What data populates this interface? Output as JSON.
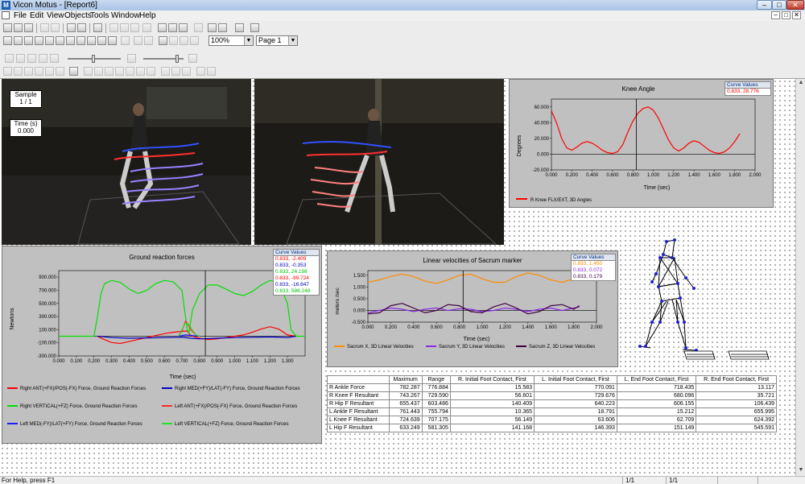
{
  "window": {
    "title": "Vicon Motus - [Report6]",
    "logo": "M"
  },
  "menu": [
    "File",
    "Edit",
    "View",
    "Objects",
    "Tools",
    "Window",
    "Help"
  ],
  "toolbar": {
    "zoom": "100%",
    "page": "Page 1"
  },
  "status": {
    "help": "For Help, press F1",
    "pane1": "1/1",
    "pane2": "1/1"
  },
  "video_overlay": {
    "sample_label": "Sample",
    "sample_value": "1 / 1",
    "time_label": "Time (s)",
    "time_value": "0.000"
  },
  "icons": {
    "scroll_up": "▲",
    "scroll_down": "▼",
    "dropdown": "▼",
    "minimize": "–",
    "maximize": "□",
    "close": "✕"
  },
  "curve_values_title": "Curve Values",
  "knee": {
    "chart_data": {
      "type": "line",
      "title": "Knee Angle",
      "xlabel": "Time (sec)",
      "ylabel": "Degrees",
      "xlim": [
        0,
        2
      ],
      "ylim": [
        -20,
        70
      ],
      "xticks": [
        "0.000",
        "0.200",
        "0.400",
        "0.600",
        "0.800",
        "1.000",
        "1.200",
        "1.400",
        "1.600",
        "1.800",
        "2.000"
      ],
      "yticks": [
        "-20.000",
        "0.000",
        "20.000",
        "40.000",
        "60.000"
      ],
      "cursor_x": 0.833,
      "series": [
        {
          "name": "R Knee FLX/EXT, 3D Angles",
          "color": "#ff0000",
          "x": [
            0.0,
            0.05,
            0.1,
            0.15,
            0.2,
            0.25,
            0.3,
            0.35,
            0.4,
            0.45,
            0.5,
            0.55,
            0.6,
            0.65,
            0.7,
            0.75,
            0.8,
            0.85,
            0.9,
            0.95,
            1.0,
            1.05,
            1.1,
            1.15,
            1.2,
            1.25,
            1.3,
            1.35,
            1.4,
            1.45,
            1.5,
            1.55,
            1.6,
            1.65,
            1.7,
            1.75,
            1.8,
            1.85
          ],
          "y": [
            55,
            40,
            20,
            8,
            5,
            9,
            14,
            16,
            14,
            10,
            5,
            2,
            1,
            3,
            12,
            28,
            42,
            52,
            58,
            60,
            56,
            46,
            32,
            18,
            8,
            4,
            8,
            14,
            17,
            15,
            10,
            5,
            2,
            1,
            3,
            8,
            16,
            26
          ]
        }
      ]
    },
    "curve_values": [
      {
        "text": "0.833,  28.776",
        "color": "#ff0000"
      }
    ]
  },
  "grf": {
    "chart_data": {
      "type": "line",
      "title": "Ground reaction forces",
      "xlabel": "Time (sec)",
      "ylabel": "Newtons",
      "xlim": [
        0,
        1.4
      ],
      "ylim": [
        -300,
        1000
      ],
      "xticks": [
        "0.000",
        "0.100",
        "0.200",
        "0.300",
        "0.400",
        "0.500",
        "0.600",
        "0.700",
        "0.800",
        "0.900",
        "1.000",
        "1.100",
        "1.200",
        "1.300"
      ],
      "yticks": [
        "-300.000",
        "-100.000",
        "100.000",
        "300.000",
        "500.000",
        "700.000",
        "900.000"
      ],
      "cursor_x": 0.833,
      "series": [
        {
          "name": "Right ANT(+FX)/POS(-FX) Force, Ground Reaction Forces",
          "color": "#ff0000",
          "x": [
            0.22,
            0.25,
            0.3,
            0.35,
            0.4,
            0.45,
            0.5,
            0.55,
            0.6,
            0.65,
            0.7,
            0.73,
            0.75,
            0.8,
            0.85,
            0.9,
            0.95,
            1.0,
            1.05,
            1.1,
            1.15,
            1.2,
            1.25,
            1.3,
            1.35
          ],
          "y": [
            0,
            -40,
            -95,
            -110,
            -80,
            -50,
            -20,
            10,
            40,
            60,
            75,
            80,
            10,
            -30,
            -50,
            -40,
            -20,
            0,
            20,
            60,
            110,
            145,
            110,
            20,
            0
          ]
        },
        {
          "name": "Right MED(+FY)/LAT(-FY) Force, Ground Reaction Forces",
          "color": "#0000c8",
          "x": [
            0.22,
            0.3,
            0.4,
            0.5,
            0.6,
            0.7,
            0.75,
            0.8,
            0.9,
            1.0,
            1.1,
            1.2,
            1.3,
            1.35
          ],
          "y": [
            0,
            -20,
            -30,
            -25,
            -20,
            -15,
            -30,
            -40,
            -30,
            -20,
            -15,
            -10,
            -20,
            0
          ]
        },
        {
          "name": "Right VERTICAL(+FZ) Force, Ground Reaction Forces",
          "color": "#00e000",
          "x": [
            0,
            0.2,
            0.22,
            0.24,
            0.26,
            0.3,
            0.35,
            0.4,
            0.45,
            0.5,
            0.55,
            0.6,
            0.65,
            0.7,
            0.72,
            0.73,
            0.74,
            0.76,
            0.8,
            0.85,
            0.9,
            0.95,
            1.0,
            1.05,
            1.1,
            1.15,
            1.2,
            1.25,
            1.3,
            1.32,
            1.35,
            1.4
          ],
          "y": [
            0,
            0,
            300,
            650,
            800,
            850,
            820,
            720,
            650,
            700,
            800,
            850,
            830,
            700,
            300,
            100,
            50,
            400,
            650,
            780,
            780,
            720,
            650,
            620,
            680,
            780,
            850,
            820,
            500,
            100,
            0,
            0
          ]
        },
        {
          "name": "Left ANT(+FX)/POS(-FX) Force, Ground Reaction Forces",
          "color": "#ff2a2a",
          "x": [
            0.68,
            0.7,
            0.72,
            0.73,
            0.75,
            0.78,
            0.8
          ],
          "y": [
            0,
            80,
            230,
            200,
            100,
            20,
            0
          ]
        },
        {
          "name": "Left MED(-FY)/LAT(+FY) Force, Ground Reaction Forces",
          "color": "#1c1cff",
          "x": [
            0.68,
            0.72,
            0.76,
            0.8
          ],
          "y": [
            0,
            20,
            10,
            0
          ]
        },
        {
          "name": "Left VERTICAL(+FZ) Force, Ground Reaction Forces",
          "color": "#28e028",
          "x": [
            0.68,
            0.7,
            0.72,
            0.74,
            0.76,
            0.78,
            0.8
          ],
          "y": [
            0,
            100,
            200,
            180,
            90,
            20,
            0
          ]
        }
      ]
    },
    "curve_values": [
      {
        "text": "0.833,  -2.409",
        "color": "#ff0000"
      },
      {
        "text": "0.833,  -0.353",
        "color": "#0000c8"
      },
      {
        "text": "0.833,  24.198",
        "color": "#00c000"
      },
      {
        "text": "0.833,  -99.724",
        "color": "#ff0000"
      },
      {
        "text": "0.833,  -16.847",
        "color": "#0000c8"
      },
      {
        "text": "0.833,  586.248",
        "color": "#00c000"
      }
    ]
  },
  "sacrum": {
    "chart_data": {
      "type": "line",
      "title": "Linear velocities of Sacrum marker",
      "xlabel": "Time (sec)",
      "ylabel": "meters /sec",
      "xlim": [
        0,
        2
      ],
      "ylim": [
        -0.5,
        1.7
      ],
      "xticks": [
        "0.000",
        "0.200",
        "0.400",
        "0.600",
        "0.800",
        "1.000",
        "1.200",
        "1.400",
        "1.600",
        "1.800",
        "2.000"
      ],
      "yticks": [
        "-0.500",
        "0.000",
        "0.500",
        "1.000",
        "1.500"
      ],
      "cursor_x": 0.833,
      "series": [
        {
          "name": "Sacrum X, 3D Linear Velocities",
          "color": "#ff8c00",
          "x": [
            0.0,
            0.1,
            0.2,
            0.3,
            0.4,
            0.5,
            0.6,
            0.7,
            0.8,
            0.9,
            1.0,
            1.1,
            1.2,
            1.3,
            1.4,
            1.5,
            1.6,
            1.7,
            1.8,
            1.85
          ],
          "y": [
            1.2,
            1.3,
            1.45,
            1.55,
            1.45,
            1.25,
            1.15,
            1.3,
            1.5,
            1.55,
            1.35,
            1.2,
            1.2,
            1.45,
            1.6,
            1.5,
            1.3,
            1.2,
            1.35,
            1.45
          ]
        },
        {
          "name": "Sacrum Y, 3D Linear Velocities",
          "color": "#8a2be2",
          "x": [
            0.0,
            0.1,
            0.2,
            0.3,
            0.4,
            0.5,
            0.6,
            0.7,
            0.8,
            0.9,
            1.0,
            1.1,
            1.2,
            1.3,
            1.4,
            1.5,
            1.6,
            1.7,
            1.8,
            1.85
          ],
          "y": [
            -0.1,
            0.0,
            0.1,
            0.05,
            -0.05,
            0.05,
            0.1,
            0.0,
            0.07,
            0.05,
            -0.05,
            0.0,
            0.1,
            0.05,
            -0.05,
            0.05,
            0.1,
            0.0,
            0.1,
            0.15
          ]
        },
        {
          "name": "Sacrum Z, 3D Linear Velocities",
          "color": "#400040",
          "x": [
            0.0,
            0.1,
            0.2,
            0.3,
            0.4,
            0.5,
            0.6,
            0.7,
            0.8,
            0.9,
            1.0,
            1.1,
            1.2,
            1.3,
            1.4,
            1.5,
            1.6,
            1.7,
            1.8,
            1.85
          ],
          "y": [
            -0.15,
            -0.1,
            0.2,
            0.3,
            0.1,
            -0.1,
            0.0,
            0.25,
            0.2,
            -0.05,
            -0.1,
            0.15,
            0.3,
            0.1,
            -0.15,
            -0.05,
            0.2,
            0.25,
            0.05,
            0.2
          ]
        }
      ]
    },
    "curve_values": [
      {
        "text": "0.833,  1.450",
        "color": "#ff8c00"
      },
      {
        "text": "0.833,  0.072",
        "color": "#8a2be2"
      },
      {
        "text": "0.833,  0.179",
        "color": "#400040"
      }
    ]
  },
  "table": {
    "headers": [
      "",
      "Maximum",
      "Range",
      "R. Initial Foot Contact, First",
      "L. Initial Foot Contact, First",
      "L. End Foot Contact, First",
      "R. End Foot Contact, First"
    ],
    "rows": [
      [
        "R Ankle Force",
        "782.287",
        "776.884",
        "15.583",
        "770.091",
        "718.435",
        "13.117"
      ],
      [
        "R Knee F Resultant",
        "743.267",
        "729.590",
        "56.601",
        "729.676",
        "680.096",
        "35.721"
      ],
      [
        "R Hip F Resultant",
        "655.437",
        "603.486",
        "140.409",
        "640.223",
        "606.155",
        "106.439"
      ],
      [
        "L Ankle F Resultant",
        "761.443",
        "755.794",
        "10.365",
        "18.791",
        "15.212",
        "655.995"
      ],
      [
        "L Knee F Resultant",
        "724.639",
        "707.175",
        "56.149",
        "63.606",
        "62.709",
        "624.392"
      ],
      [
        "L Hip F Resultant",
        "633.249",
        "581.305",
        "141.168",
        "146.393",
        "151.149",
        "545.591"
      ]
    ]
  }
}
